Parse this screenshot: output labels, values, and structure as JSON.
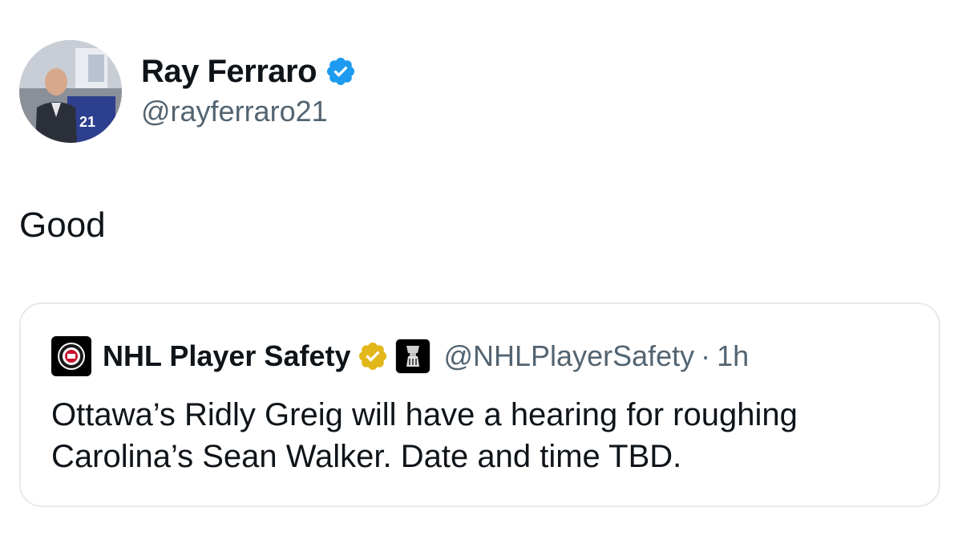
{
  "tweet": {
    "author": {
      "name": "Ray Ferraro",
      "handle": "@rayferraro21",
      "verified": true
    },
    "text": "Good"
  },
  "quoted_tweet": {
    "author": {
      "name": "NHL Player Safety",
      "handle": "@NHLPlayerSafety",
      "badges": [
        "gold-verified-icon",
        "stanley-cup-affiliate-icon"
      ]
    },
    "separator": "·",
    "time": "1h",
    "text": "Ottawa’s Ridly Greig will have a hearing for roughing Carolina’s Sean Walker. Date and time TBD."
  },
  "colors": {
    "text_primary": "#0f1419",
    "text_secondary": "#536471",
    "verified_blue": "#1d9bf0",
    "verified_gold": "#e2b719",
    "card_border": "#e6e9ec"
  }
}
